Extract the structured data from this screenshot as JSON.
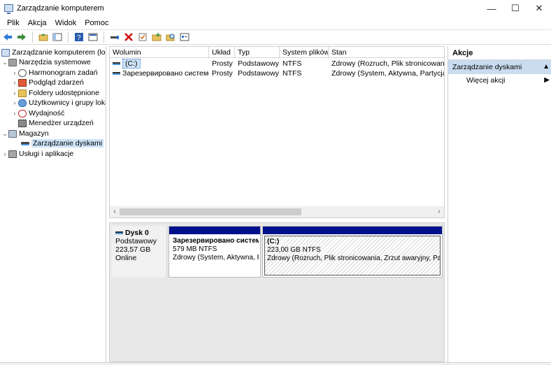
{
  "window": {
    "title": "Zarządzanie komputerem",
    "minimize": "—",
    "maximize": "☐",
    "close": "✕"
  },
  "menu": [
    "Plik",
    "Akcja",
    "Widok",
    "Pomoc"
  ],
  "toolbar_icons": [
    "back-arrow-icon",
    "forward-arrow-icon",
    "up-folder-icon",
    "show-hide-tree-icon",
    "help-icon",
    "properties-icon",
    "connect-icon",
    "delete-icon",
    "checklist-icon",
    "folder-add-icon",
    "folder-search-icon",
    "console-icon"
  ],
  "tree": {
    "root": "Zarządzanie komputerem (lokalne)",
    "system_tools": "Narzędzia systemowe",
    "task_scheduler": "Harmonogram zadań",
    "event_viewer": "Podgląd zdarzeń",
    "shared_folders": "Foldery udostępnione",
    "local_users": "Użytkownicy i grupy lokalne",
    "performance": "Wydajność",
    "device_manager": "Menedżer urządzeń",
    "storage": "Magazyn",
    "disk_management": "Zarządzanie dyskami",
    "services": "Usługi i aplikacje"
  },
  "list": {
    "headers": [
      "Wolumin",
      "Układ",
      "Typ",
      "System plików",
      "Stan"
    ],
    "rows": [
      {
        "volume": "(C:)",
        "layout": "Prosty",
        "type": "Podstawowy",
        "fs": "NTFS",
        "status": "Zdrowy (Rozruch, Plik stronicowania, Zrzut awaryjny, Partycja podstawowa)"
      },
      {
        "volume": "Зарезервировано системой",
        "layout": "Prosty",
        "type": "Podstawowy",
        "fs": "NTFS",
        "status": "Zdrowy (System, Aktywna, Partycja podstawowa)"
      }
    ]
  },
  "disk": {
    "name": "Dysk 0",
    "type": "Podstawowy",
    "size": "223,57 GB",
    "state": "Online",
    "partitions": [
      {
        "name": "Зарезервировано системой",
        "size": "579 MB NTFS",
        "status": "Zdrowy (System, Aktywna, Partycja podstawowa)"
      },
      {
        "name": "(C:)",
        "size": "223,00 GB NTFS",
        "status": "Zdrowy (Rozruch, Plik stronicowania, Zrzut awaryjny, Partycja podstawowa)"
      }
    ]
  },
  "actions": {
    "title": "Akcje",
    "section": "Zarządzanie dyskami",
    "more": "Więcej akcji",
    "section_arrow": "▲",
    "more_arrow": "▶"
  }
}
